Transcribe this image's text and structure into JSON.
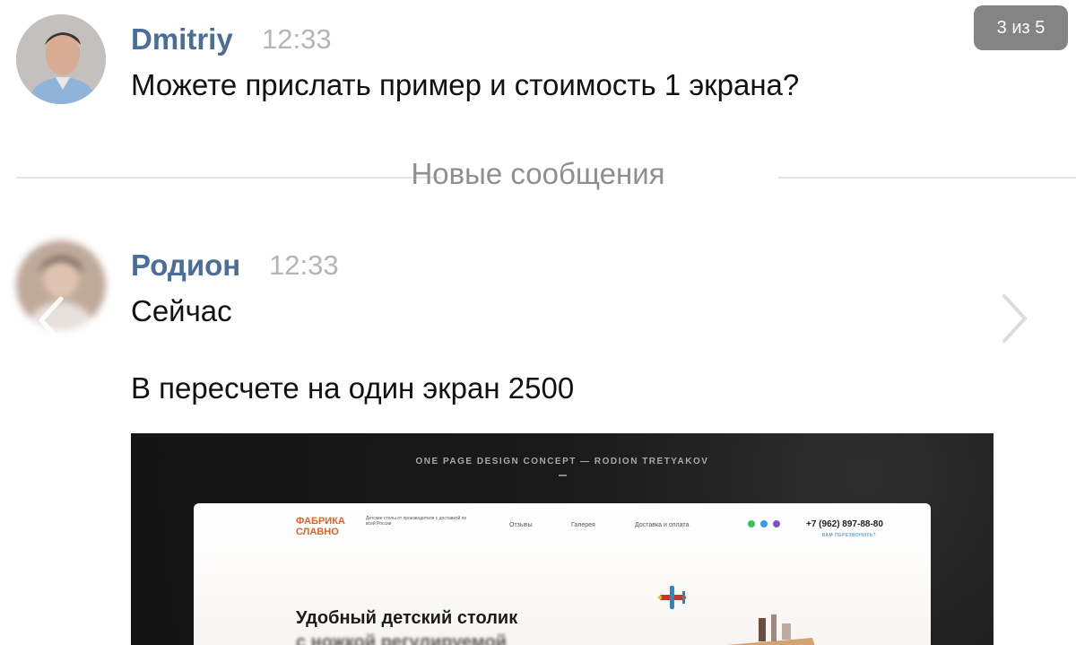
{
  "viewer": {
    "counter": "3 из 5"
  },
  "messages": [
    {
      "author": "Dmitriy",
      "time": "12:33",
      "text": "Можете прислать пример и стоимость 1 экрана?"
    },
    {
      "author": "Родион",
      "time": "12:33",
      "lines": [
        "Сейчас",
        "В пересчете на один экран 2500"
      ]
    }
  ],
  "divider": {
    "label": "Новые сообщения"
  },
  "preview": {
    "caption": "ONE PAGE DESIGN CONCEPT — RODION TRETYAKOV",
    "logo_line1": "ФАБРИКА",
    "logo_line2": "СЛАВНО",
    "tagline": "Детские столы от производителя с доставкой по всей России",
    "nav": [
      "Отзывы",
      "Галерея",
      "Доставка и оплата"
    ],
    "phone": "+7 (962) 897-88-80",
    "callback": "ВАМ ПЕРЕЗВОНИТЬ?",
    "heading": "Удобный детский столик",
    "heading2": "с ножкой регулируемой",
    "colors": {
      "logo": "#e0622c",
      "link": "#2a7fd4"
    }
  },
  "icons": {
    "prev": "chevron-left-icon",
    "next": "chevron-right-icon"
  },
  "colors": {
    "author": "#4a6e97",
    "time": "#b5b5b5",
    "divider_text": "#8f8f8f"
  }
}
